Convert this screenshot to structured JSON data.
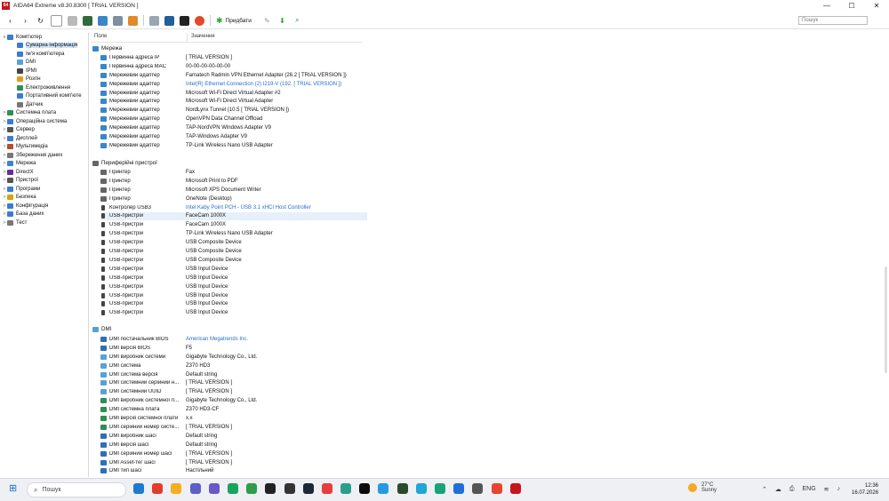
{
  "window": {
    "icon_text": "64",
    "title": "AIDA64 Extreme v8.30.8300  [ TRIAL VERSION ]",
    "controls": [
      "—",
      "☐",
      "✕"
    ]
  },
  "toolbar": {
    "report_label": "Придбати",
    "search_placeholder": "Пошук"
  },
  "tree": [
    {
      "label": "Комп'ютер",
      "level": 0,
      "exp": "v",
      "color": "#3a7bd5"
    },
    {
      "label": "Сумарна інформація",
      "level": 1,
      "exp": "",
      "color": "#3a7bd5",
      "selected": true
    },
    {
      "label": "Ім'я комп'ютера",
      "level": 1,
      "exp": "",
      "color": "#3a7bd5"
    },
    {
      "label": "DMI",
      "level": 1,
      "exp": "",
      "color": "#5aa0d8"
    },
    {
      "label": "IPMI",
      "level": 1,
      "exp": "",
      "color": "#444"
    },
    {
      "label": "Розгін",
      "level": 1,
      "exp": "",
      "color": "#e39b20"
    },
    {
      "label": "Електроживлення",
      "level": 1,
      "exp": "",
      "color": "#2f8f4f"
    },
    {
      "label": "Портативний комп'юте",
      "level": 1,
      "exp": "",
      "color": "#3a7bd5"
    },
    {
      "label": "Датчик",
      "level": 1,
      "exp": "",
      "color": "#777"
    },
    {
      "label": "Системна плата",
      "level": 0,
      "exp": ">",
      "color": "#2f8f4f"
    },
    {
      "label": "Операційна система",
      "level": 0,
      "exp": ">",
      "color": "#3a7bd5"
    },
    {
      "label": "Сервер",
      "level": 0,
      "exp": ">",
      "color": "#555"
    },
    {
      "label": "Дисплей",
      "level": 0,
      "exp": ">",
      "color": "#3a7bd5"
    },
    {
      "label": "Мультимедіа",
      "level": 0,
      "exp": ">",
      "color": "#c04a2a"
    },
    {
      "label": "Збереження даних",
      "level": 0,
      "exp": ">",
      "color": "#777"
    },
    {
      "label": "Мережа",
      "level": 0,
      "exp": ">",
      "color": "#3a86c8"
    },
    {
      "label": "DirectX",
      "level": 0,
      "exp": ">",
      "color": "#6a2a9a"
    },
    {
      "label": "Пристрої",
      "level": 0,
      "exp": ">",
      "color": "#555"
    },
    {
      "label": "Програми",
      "level": 0,
      "exp": ">",
      "color": "#3a7bd5"
    },
    {
      "label": "Безпека",
      "level": 0,
      "exp": ">",
      "color": "#d7a400"
    },
    {
      "label": "Конфігурація",
      "level": 0,
      "exp": ">",
      "color": "#3a7bd5"
    },
    {
      "label": "База даних",
      "level": 0,
      "exp": ">",
      "color": "#3a7bd5"
    },
    {
      "label": "Тест",
      "level": 0,
      "exp": ">",
      "color": "#777"
    }
  ],
  "columns": {
    "field": "Поле",
    "value": "Значення"
  },
  "sections": {
    "network": "Мережа",
    "peripherals": "Периферійні пристрої",
    "dmi": "DMI"
  },
  "network_rows": [
    {
      "f": "Первинна адреса IP",
      "v": "[ TRIAL VERSION ]"
    },
    {
      "f": "Первинна адреса MAC",
      "v": "00-00-00-00-00-00"
    },
    {
      "f": "Мережевий адаптер",
      "v": "Famatech Radmin VPN Ethernet Adapter  (26.2 [ TRIAL VERSION ])"
    },
    {
      "f": "Мережевий адаптер",
      "v": "Intel(R) Ethernet Connection (2) I219-V  (192. [ TRIAL VERSION ])",
      "link": true
    },
    {
      "f": "Мережевий адаптер",
      "v": "Microsoft Wi-Fi Direct Virtual Adapter #2"
    },
    {
      "f": "Мережевий адаптер",
      "v": "Microsoft Wi-Fi Direct Virtual Adapter"
    },
    {
      "f": "Мережевий адаптер",
      "v": "NordLynx Tunnel  (10.5 [ TRIAL VERSION ])"
    },
    {
      "f": "Мережевий адаптер",
      "v": "OpenVPN Data Channel Offload"
    },
    {
      "f": "Мережевий адаптер",
      "v": "TAP-NordVPN Windows Adapter V9"
    },
    {
      "f": "Мережевий адаптер",
      "v": "TAP-Windows Adapter V9"
    },
    {
      "f": "Мережевий адаптер",
      "v": "TP-Link Wireless Nano USB Adapter"
    }
  ],
  "peripheral_rows": [
    {
      "f": "Принтер",
      "v": "Fax",
      "t": "dev"
    },
    {
      "f": "Принтер",
      "v": "Microsoft Print to PDF",
      "t": "dev"
    },
    {
      "f": "Принтер",
      "v": "Microsoft XPS Document Writer",
      "t": "dev"
    },
    {
      "f": "Принтер",
      "v": "OneNote (Desktop)",
      "t": "dev"
    },
    {
      "f": "Контролер USB3",
      "v": "Intel Kaby Point PCH - USB 3.1 xHCI Host Controller",
      "t": "usb",
      "link": true
    },
    {
      "f": "USB-пристрій",
      "v": "FaceCam 1000X",
      "t": "usb",
      "hl": true
    },
    {
      "f": "USB-пристрій",
      "v": "FaceCam 1000X",
      "t": "usb"
    },
    {
      "f": "USB-пристрій",
      "v": "TP-Link Wireless Nano USB Adapter",
      "t": "usb"
    },
    {
      "f": "USB-пристрій",
      "v": "USB Composite Device",
      "t": "usb"
    },
    {
      "f": "USB-пристрій",
      "v": "USB Composite Device",
      "t": "usb"
    },
    {
      "f": "USB-пристрій",
      "v": "USB Composite Device",
      "t": "usb"
    },
    {
      "f": "USB-пристрій",
      "v": "USB Input Device",
      "t": "usb"
    },
    {
      "f": "USB-пристрій",
      "v": "USB Input Device",
      "t": "usb"
    },
    {
      "f": "USB-пристрій",
      "v": "USB Input Device",
      "t": "usb"
    },
    {
      "f": "USB-пристрій",
      "v": "USB Input Device",
      "t": "usb"
    },
    {
      "f": "USB-пристрій",
      "v": "USB Input Device",
      "t": "usb"
    },
    {
      "f": "USB-пристрій",
      "v": "USB Input Device",
      "t": "usb"
    }
  ],
  "dmi_rows": [
    {
      "f": "DMI постачальник BIOS",
      "v": "American Megatrends Inc.",
      "t": "sys",
      "link": true
    },
    {
      "f": "DMI версія BIOS",
      "v": "F5",
      "t": "sys"
    },
    {
      "f": "DMI виробник системи",
      "v": "Gigabyte Technology Co., Ltd.",
      "t": "dmi"
    },
    {
      "f": "DMI система",
      "v": "Z370 HD3",
      "t": "dmi"
    },
    {
      "f": "DMI система версія",
      "v": "Default string",
      "t": "dmi"
    },
    {
      "f": "DMI системний серійний н...",
      "v": "[ TRIAL VERSION ]",
      "t": "dmi"
    },
    {
      "f": "DMI системний UUID",
      "v": "[ TRIAL VERSION ]",
      "t": "dmi"
    },
    {
      "f": "DMI виробник системної п...",
      "v": "Gigabyte Technology Co., Ltd.",
      "t": "board"
    },
    {
      "f": "DMI системна плата",
      "v": "Z370 HD3-CF",
      "t": "board"
    },
    {
      "f": "DMI версія системної плати",
      "v": "x.x",
      "t": "board"
    },
    {
      "f": "DMI серійний номер систе...",
      "v": "[ TRIAL VERSION ]",
      "t": "board"
    },
    {
      "f": "DMI виробник шасі",
      "v": "Default string",
      "t": "sys"
    },
    {
      "f": "DMI версія шасі",
      "v": "Default string",
      "t": "sys"
    },
    {
      "f": "DMI серійний номер шасі",
      "v": "[ TRIAL VERSION ]",
      "t": "sys"
    },
    {
      "f": "DMI Asset-тег шасі",
      "v": "[ TRIAL VERSION ]",
      "t": "sys"
    },
    {
      "f": "DMI тип шасі",
      "v": "Настільний",
      "t": "sys"
    }
  ],
  "taskbar": {
    "search_label": "Пошук",
    "apps": [
      "#1f78d1",
      "#e33b2e",
      "#f2b01e",
      "#5b5fc7",
      "#6b57c7",
      "#17a55e",
      "#2e9c4b",
      "#222",
      "#333",
      "#1b2838",
      "#e63d3d",
      "#2a9d8f",
      "#0b0b0b",
      "#239ae2",
      "#2a4a2a",
      "#22a6d8",
      "#1aa37a",
      "#1e6fd9",
      "#555",
      "#e8442f",
      "#c4161c"
    ],
    "weather_temp": "27°C",
    "weather_desc": "Sunny",
    "lang": "ENG",
    "time": "12:36",
    "date": "16.07.2026"
  }
}
